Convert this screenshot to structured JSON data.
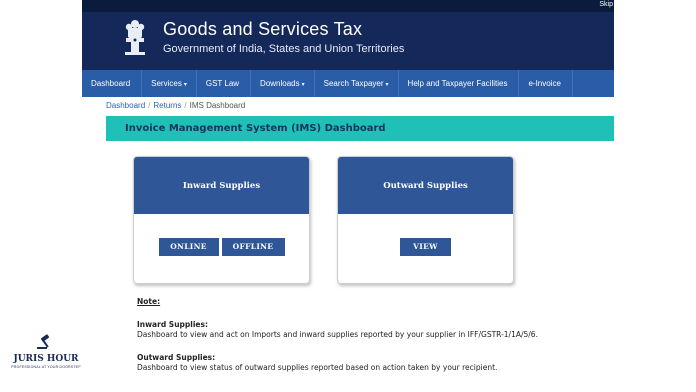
{
  "topbar": {
    "skip_label": "Skip"
  },
  "header": {
    "title": "Goods and Services Tax",
    "subtitle": "Government of India, States and Union Territories",
    "emblem_icon": "national-emblem-icon"
  },
  "nav": {
    "items": [
      {
        "label": "Dashboard",
        "caret": ""
      },
      {
        "label": "Services",
        "caret": "▾"
      },
      {
        "label": "GST Law",
        "caret": ""
      },
      {
        "label": "Downloads",
        "caret": "▾"
      },
      {
        "label": "Search Taxpayer",
        "caret": "▾"
      },
      {
        "label": "Help and Taxpayer Facilities",
        "caret": ""
      },
      {
        "label": "e-Invoice",
        "caret": ""
      }
    ]
  },
  "breadcrumb": {
    "items": [
      "Dashboard",
      "Returns",
      "IMS Dashboard"
    ]
  },
  "banner": {
    "title": "Invoice Management System (IMS) Dashboard"
  },
  "cards": {
    "inward": {
      "title": "Inward Supplies",
      "online_label": "ONLINE",
      "offline_label": "OFFLINE"
    },
    "outward": {
      "title": "Outward Supplies",
      "view_label": "VIEW"
    }
  },
  "notes": {
    "heading": "Note:",
    "inward_title": "Inward Supplies:",
    "inward_text": "Dashboard to view and act on Imports and inward supplies reported by your supplier in IFF/GSTR-1/1A/5/6.",
    "outward_title": "Outward Supplies:",
    "outward_text": "Dashboard to view status of outward supplies reported based on action taken by your recipient."
  },
  "watermark": {
    "name": "JURIS HOUR",
    "tagline": "PROFESSIONAL AT YOUR DOORSTEP",
    "icon": "gavel-icon"
  },
  "colors": {
    "header": "#15285a",
    "nav": "#2a5da8",
    "banner": "#1fc1b7",
    "card_head": "#2f5697"
  }
}
